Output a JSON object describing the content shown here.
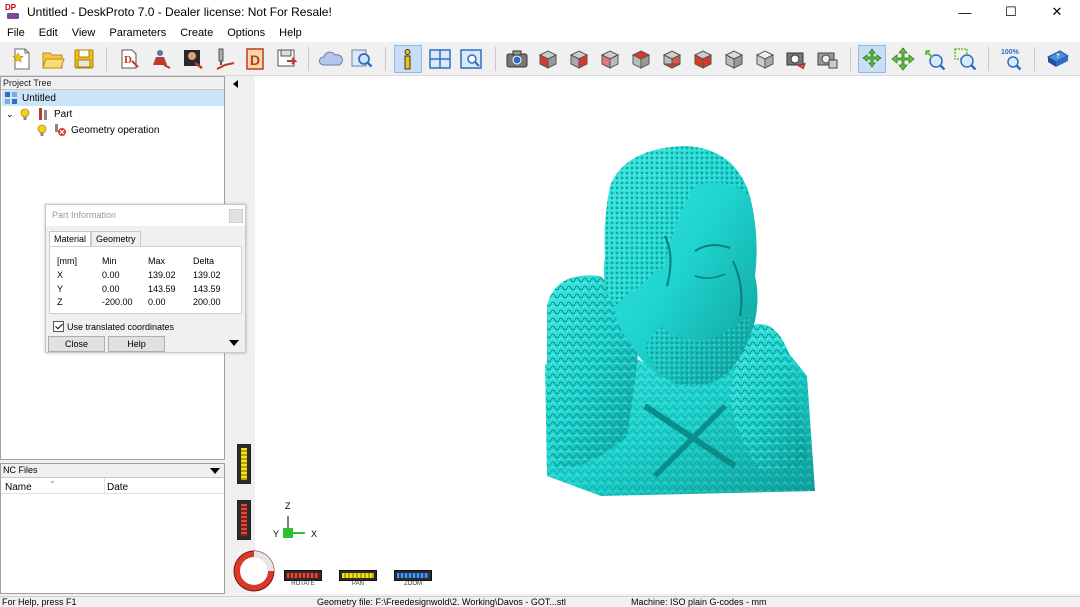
{
  "window": {
    "title": "Untitled - DeskProto 7.0 - Dealer license: Not For Resale!",
    "app_icon_text": "DP",
    "minimize_label": "—",
    "maximize_label": "☐",
    "close_label": "✕"
  },
  "menu": [
    "File",
    "Edit",
    "View",
    "Parameters",
    "Create",
    "Options",
    "Help"
  ],
  "toolbar": {
    "icons": [
      "new-file-icon",
      "open-folder-icon",
      "save-disk-icon",
      "part-wizard-icon",
      "vector-wizard-icon",
      "bitmap-wizard-icon",
      "operation-wizard-icon",
      "drawing-icon",
      "save-nc-icon",
      "cloud-icon",
      "search-icon",
      "info-icon",
      "window-layout-icon",
      "display-settings-icon",
      "camera-icon",
      "view-front-icon",
      "view-back-icon",
      "view-left-icon",
      "view-right-icon",
      "view-top-icon",
      "view-bottom-icon",
      "view-iso-1-icon",
      "view-iso-2-icon",
      "view-reset-icon",
      "view-save-icon",
      "rotate-tool-icon",
      "pan-tool-icon",
      "zoom-in-tool-icon",
      "zoom-window-tool-icon",
      "zoom-100-icon",
      "help-book-icon"
    ],
    "zoom_label": "100%"
  },
  "project_tree": {
    "header": "Project Tree",
    "items": [
      {
        "label": "Untitled",
        "level": 0,
        "selected": true
      },
      {
        "label": "Part",
        "level": 1,
        "selected": false
      },
      {
        "label": "Geometry operation",
        "level": 2,
        "selected": false
      }
    ]
  },
  "part_info": {
    "title": "Part Information",
    "tabs": [
      "Material",
      "Geometry"
    ],
    "active_tab": "Material",
    "headers": [
      "[mm]",
      "Min",
      "Max",
      "Delta"
    ],
    "rows": [
      {
        "axis": "X",
        "min": "0.00",
        "max": "139.02",
        "delta": "139.02"
      },
      {
        "axis": "Y",
        "min": "0.00",
        "max": "143.59",
        "delta": "143.59"
      },
      {
        "axis": "Z",
        "min": "-200.00",
        "max": "0.00",
        "delta": "200.00"
      }
    ],
    "checkbox_label": "Use translated coordinates",
    "checkbox_checked": true,
    "close_button": "Close",
    "help_button": "Help"
  },
  "nc_files": {
    "header": "NC Files",
    "columns": [
      "Name",
      "Date"
    ]
  },
  "viewport": {
    "model_color": "#1fd4cf",
    "axis_labels": {
      "x": "X",
      "y": "Y",
      "z": "Z"
    },
    "controls": [
      {
        "label": "ROTATE",
        "color": "#d83a2a"
      },
      {
        "label": "PAN",
        "color": "#e8d820"
      },
      {
        "label": "ZOOM",
        "color": "#2e7fd8"
      }
    ]
  },
  "statusbar": {
    "help": "For Help, press F1",
    "geometry": "Geometry file: F:\\Freedesignwold\\2. Working\\Davos - GOT...stl",
    "machine": "Machine: ISO plain G-codes - mm"
  }
}
